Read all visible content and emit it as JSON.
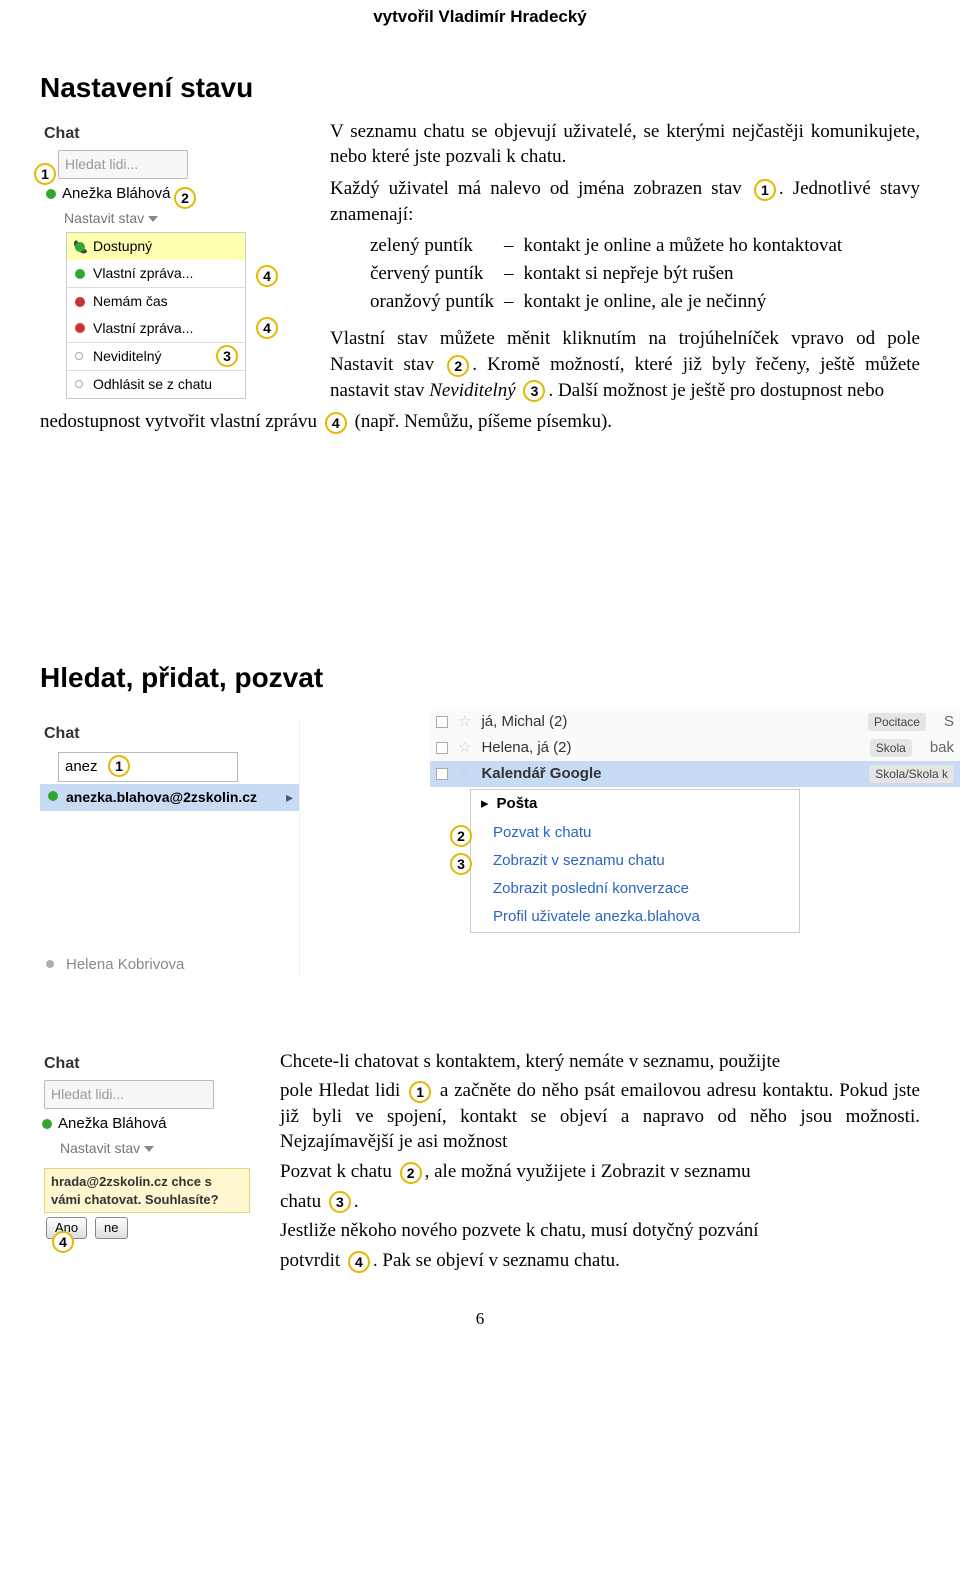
{
  "credit": "vytvořil Vladimír Hradecký",
  "section1": {
    "title": "Nastavení stavu",
    "shot": {
      "chat_label": "Chat",
      "search_placeholder": "Hledat lidi...",
      "contact": "Anežka Bláhová",
      "status_label": "Nastavit stav",
      "dd": {
        "dostupny": "Dostupný",
        "vlastni1": "Vlastní zpráva...",
        "nemam": "Nemám čas",
        "vlastni2": "Vlastní zpráva...",
        "neviditelny": "Neviditelný",
        "odhlasit": "Odhlásit se z chatu"
      }
    },
    "p1": "V seznamu chatu se objevují uživatelé, se kterými nejčastěji komunikujete, nebo které jste pozvali k chatu.",
    "p2a": "Každý uživatel má nalevo od jména zobrazen stav ",
    "p2b": ". Jednotlivé stavy znamenají:",
    "legend": {
      "r1a": "zelený puntík",
      "r1b": "kontakt je online a můžete ho kontaktovat",
      "r2a": "červený puntík",
      "r2b": "kontakt si nepřeje být rušen",
      "r3a": "oranžový puntík",
      "r3b": "kontakt je online, ale je nečinný"
    },
    "p3a": "Vlastní stav můžete měnit kliknutím na trojúhelníček vpravo od pole Nastavit stav ",
    "p3b": ". Kromě možností, které již byly řečeny, ještě můžete nastavit stav ",
    "p3c": "Neviditelný",
    "p3d": ". Další možnost je ještě pro dostupnost nebo ",
    "p4a": "nedostupnost vytvořit vlastní zprávu ",
    "p4b": " (např. Nemůžu, píšeme písemku)."
  },
  "section2": {
    "title": "Hledat, přidat, pozvat",
    "shotA": {
      "chat_label": "Chat",
      "input_value": "anez",
      "result": "anezka.blahova@2zskolin.cz",
      "blurred": "Helena Kobrivova"
    },
    "shotB": {
      "rows": {
        "r1": "já, Michal (2)",
        "r2": "Helena, já (2)",
        "r3": "Kalendář Google"
      },
      "tags": {
        "t1": "Pocitace",
        "t2": "Skola",
        "t3": "Skola/Skola k"
      },
      "extra": {
        "s": "S",
        "bak": "bak"
      },
      "menu": {
        "head": "Pošta",
        "m1": "Pozvat k chatu",
        "m2": "Zobrazit v seznamu chatu",
        "m3": "Zobrazit poslední konverzace",
        "m4": "Profil uživatele anezka.blahova"
      }
    },
    "shotC": {
      "chat_label": "Chat",
      "search_placeholder": "Hledat lidi...",
      "contact": "Anežka Bláhová",
      "status_label": "Nastavit stav",
      "invite_text": "hrada@2zskolin.cz chce s vámi chatovat. Souhlasíte?",
      "btn_yes": "Ano",
      "btn_no": "ne"
    },
    "t1a": "Chcete-li chatovat s kontaktem, který nemáte v seznamu, použijte",
    "t2a": "pole Hledat lidi ",
    "t2b": " a začněte do něho psát emailovou adresu kontaktu. Pokud jste již byli ve spojení, kontakt se objeví a napravo od něho jsou možnosti. Nejzajímavější je asi možnost",
    "t3a": "Pozvat k chatu ",
    "t3b": ", ale možná využijete i Zobrazit v seznamu",
    "t4a": "chatu ",
    "t4b": ".",
    "t5": "Jestliže někoho nového pozvete k chatu, musí dotyčný pozvání",
    "t6a": "potvrdit ",
    "t6b": ". Pak se objeví v seznamu chatu."
  },
  "page_number": "6"
}
